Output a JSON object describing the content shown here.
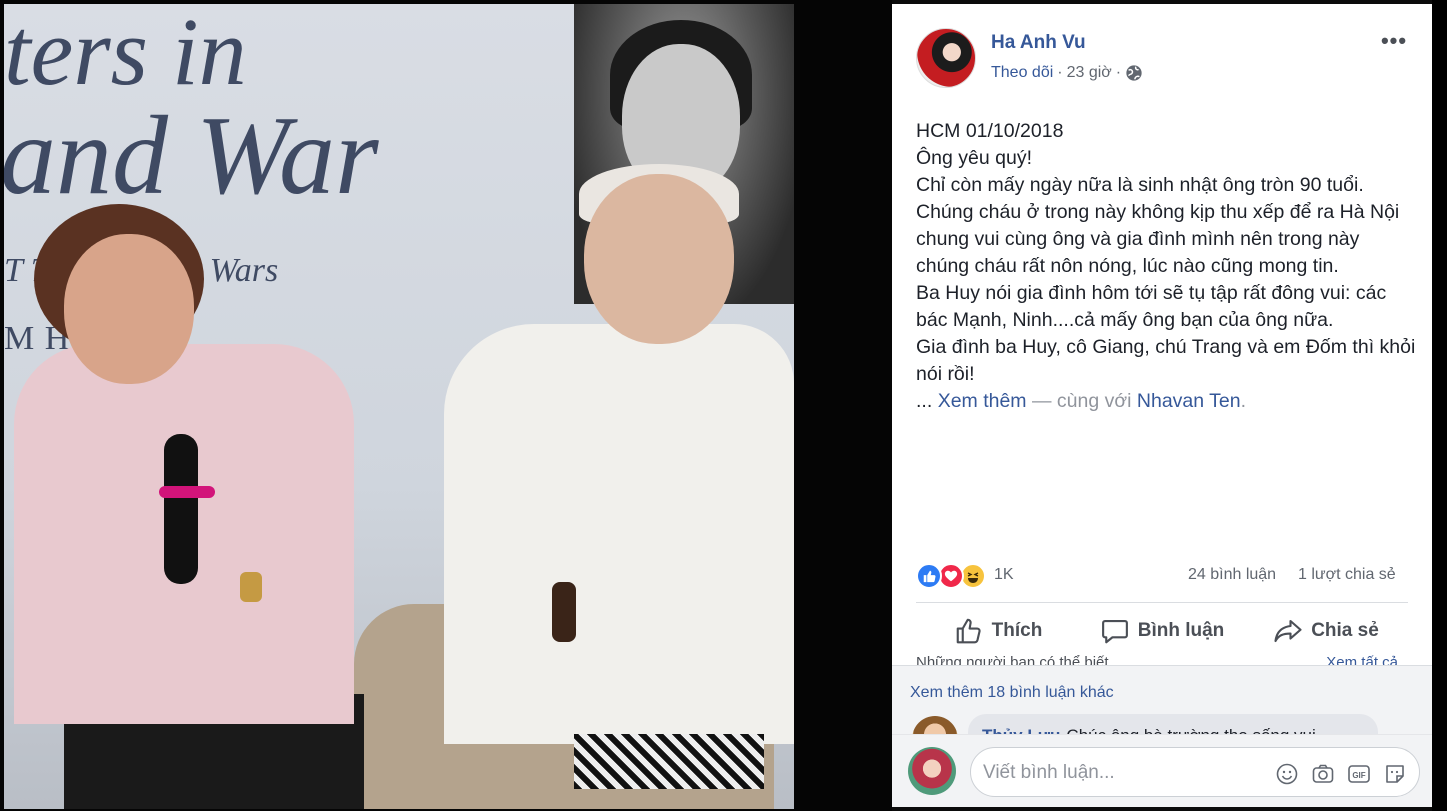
{
  "photo": {
    "banner_line1": "ters in",
    "banner_line2": "and War",
    "banner_line3": "T The Vietnam Wars",
    "banner_line4": "M HUONG"
  },
  "post": {
    "author": "Ha Anh Vu",
    "follow_label": "Theo dõi",
    "time": "23 giờ",
    "separator": "·",
    "more_label": "•••",
    "body_lines": [
      "HCM 01/10/2018",
      "Ông yêu quý!",
      "Chỉ còn mấy ngày nữa là sinh nhật ông tròn 90 tuổi. Chúng cháu ở trong này không kịp thu xếp để ra Hà Nội chung vui cùng ông và gia đình mình nên trong này chúng cháu rất nôn nóng, lúc nào cũng mong tin.",
      "Ba Huy nói gia đình hôm tới sẽ tụ tập rất đông vui: các bác Mạnh, Ninh....cả mấy ông bạn của ông nữa.",
      "Gia đình ba Huy, cô Giang, chú Trang và em Đốm thì khỏi nói rồi!"
    ],
    "see_more_prefix": "...",
    "see_more_label": "Xem thêm",
    "with_text": " — cùng với ",
    "tagged_person": "Nhavan Ten",
    "tail": "."
  },
  "reactions": {
    "count": "1K",
    "comments": "24 bình luận",
    "shares": "1 lượt chia sẻ"
  },
  "actions": {
    "like": "Thích",
    "comment": "Bình luận",
    "share": "Chia sẻ"
  },
  "peek": {
    "left": "Những người bạn có thể biết",
    "right": "Xem tất cả"
  },
  "comments": {
    "more_label": "Xem thêm 18 bình luận khác",
    "preview_name": "Thủy Lưu",
    "preview_text": "Chúc ông bà trường thọ sống vui"
  },
  "composer": {
    "placeholder": "Viết bình luận..."
  },
  "colors": {
    "link": "#365899",
    "like": "#2d7bf4",
    "love": "#f0284a",
    "haha": "#f7c33d"
  }
}
